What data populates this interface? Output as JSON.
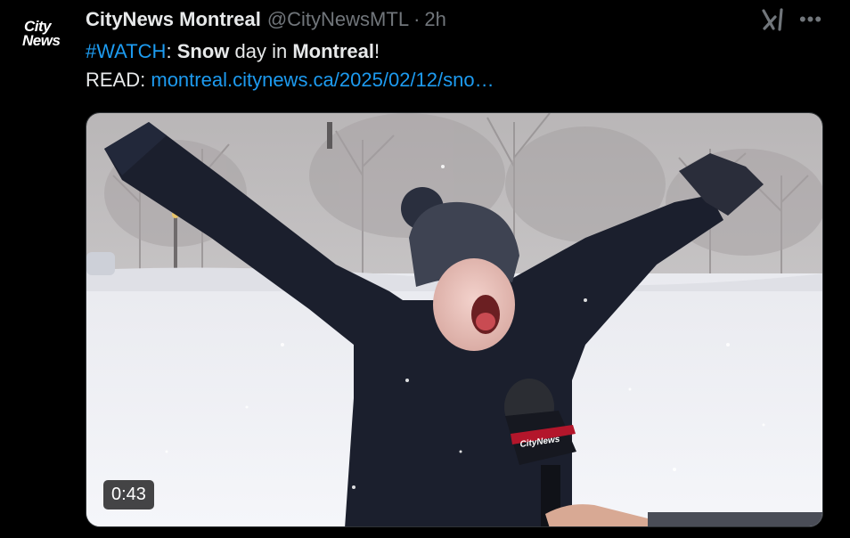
{
  "account": {
    "logo_line1": "City",
    "logo_line2": "News",
    "display_name": "CityNews Montreal",
    "handle": "@CityNewsMTL",
    "separator": "·",
    "time": "2h"
  },
  "tweet": {
    "hashtag": "#WATCH",
    "colon": ":",
    "word_snow": "Snow",
    "word_day_in": "day in",
    "word_montreal": "Montreal",
    "exclaim": "!",
    "read_label": "READ:",
    "link_text": "montreal.citynews.ca/2025/02/12/sno…"
  },
  "media": {
    "duration": "0:43",
    "mic_flag_text": "CityNews"
  },
  "icons": {
    "grok": "grok-icon",
    "more": "more-options-icon"
  },
  "colors": {
    "background": "#000000",
    "text": "#e7e9ea",
    "secondary": "#71767b",
    "link": "#1d9bf0"
  }
}
